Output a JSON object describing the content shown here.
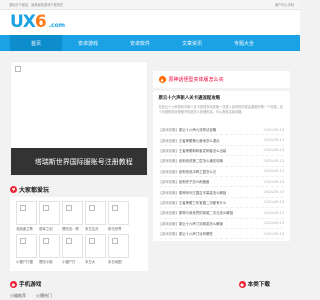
{
  "topbar": {
    "left_text": "游玩乐下载站，最新最热游戏下载尽在",
    "right_text": "用户中心手机"
  },
  "logo": {
    "part1": "UX",
    "part2": "6",
    "suffix": ".com"
  },
  "nav": {
    "items": [
      {
        "label": "首页"
      },
      {
        "label": "安卓游戏"
      },
      {
        "label": "安卓软件"
      },
      {
        "label": "文章资讯"
      },
      {
        "label": "专题大全"
      }
    ]
  },
  "slider": {
    "caption": "塔瑞斯世界国际服账号注册教程"
  },
  "games_section": {
    "title": "大家都爱玩",
    "rows": [
      [
        "流浪者之歌",
        "冠军之剑",
        "冒险岛：联",
        "末日生存",
        "射击世界"
      ],
      [
        "小僵尸打僵",
        "冒险小镇",
        "小僵尸打",
        "末日大",
        "末日地图"
      ]
    ]
  },
  "banner": {
    "text": "原神话怪型实体版怎么买"
  },
  "featured": {
    "title": "原云十六声新人关卡通流程攻略",
    "desc": "在燕云十六声游戏中新人关卡是很多玩家第一次进入游戏的时候会遇到的第一个问题，这个问题很多玩家都不知道怎么处理的话，可以看看这篇攻略。"
  },
  "news": [
    {
      "tag": "【游戏攻略】",
      "title": "原云十六声九流阵法攻略",
      "date": "2024-09-13"
    },
    {
      "tag": "【游戏攻略】",
      "title": "王者荣耀第九营地怎么退出",
      "date": "2024-09-13"
    },
    {
      "tag": "【游戏攻略】",
      "title": "王者荣耀和刺客发刺客怎么出装",
      "date": "2024-09-13"
    },
    {
      "tag": "【游戏攻略】",
      "title": "纸狗传说第二层怎么通关攻略",
      "date": "2024-09-13"
    },
    {
      "tag": "【游戏攻略】",
      "title": "纸狗传说冲锋之翼怎么去",
      "date": "2024-09-13"
    },
    {
      "tag": "【游戏攻略】",
      "title": "纸狗完子怎么刷速度",
      "date": "2024-09-13"
    },
    {
      "tag": "【游戏攻略】",
      "title": "原神系列王国吉天幂金怎么解锁",
      "date": "2024-09-13"
    },
    {
      "tag": "【游戏攻略】",
      "title": "王者荣耀三年宝箱二次都有什么",
      "date": "2024-09-13"
    },
    {
      "tag": "【游戏攻略】",
      "title": "原神与我世界的英雄二次元怎么解锁",
      "date": "2024-09-13"
    },
    {
      "tag": "【游戏攻略】",
      "title": "原云十六声门派精英怎么解锁",
      "date": "2024-09-13"
    },
    {
      "tag": "【游戏攻略】",
      "title": "原云十六声门派有哪些",
      "date": "2024-09-13"
    }
  ],
  "bottom": {
    "left_title": "手机游戏",
    "right_title": "本类下载",
    "tabs": [
      "小编推荐",
      "火爆热门"
    ]
  },
  "colors": {
    "accent": "#1aa2e4",
    "active_nav": "#0d8dcc",
    "hot": "#e03"
  }
}
